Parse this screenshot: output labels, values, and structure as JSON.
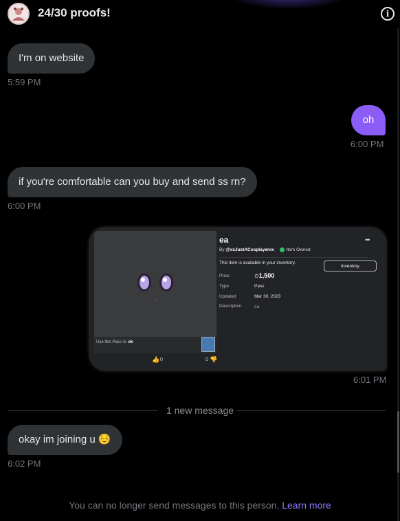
{
  "header": {
    "title": "24/30 proofs!",
    "info_icon": "info-circle-icon"
  },
  "messages": [
    {
      "text": "I'm on website",
      "time": "5:59 PM",
      "side": "in"
    },
    {
      "text": "oh",
      "time": "6:00 PM",
      "side": "out"
    },
    {
      "text": "if you're comfortable can you buy and send ss rn?",
      "time": "6:00 PM",
      "side": "in"
    },
    {
      "time": "6:01 PM",
      "side": "out",
      "type": "image"
    },
    {
      "text": "okay im joining u ☺️",
      "time": "6:02 PM",
      "side": "in"
    }
  ],
  "screenshot": {
    "item_name": "ea",
    "by_prefix": "By",
    "creator": "@xxJustACosplayerxx",
    "owned": "Item Owned",
    "available_text": "This item is available in your inventory.",
    "inventory_button": "Inventory",
    "price_label": "Price",
    "price_value": "1,500",
    "type_label": "Type",
    "type_value": "Pass",
    "updated_label": "Updated",
    "updated_value": "Mar 30, 2023",
    "description_label": "Description",
    "description_value": "ea",
    "use_pass_prefix": "Use this Pass in:",
    "use_pass_game": "ok",
    "upvotes": "0",
    "downvotes": "0",
    "more_icon": "ellipsis-icon"
  },
  "separator": "1 new message",
  "footer": {
    "text": "You can no longer send messages to this person.",
    "link": "Learn more"
  },
  "colors": {
    "outgoing_bubble": "#8b5cf6",
    "incoming_bubble": "#2f3336",
    "link": "#8b7cff",
    "owned_badge": "#2bbf6a"
  }
}
